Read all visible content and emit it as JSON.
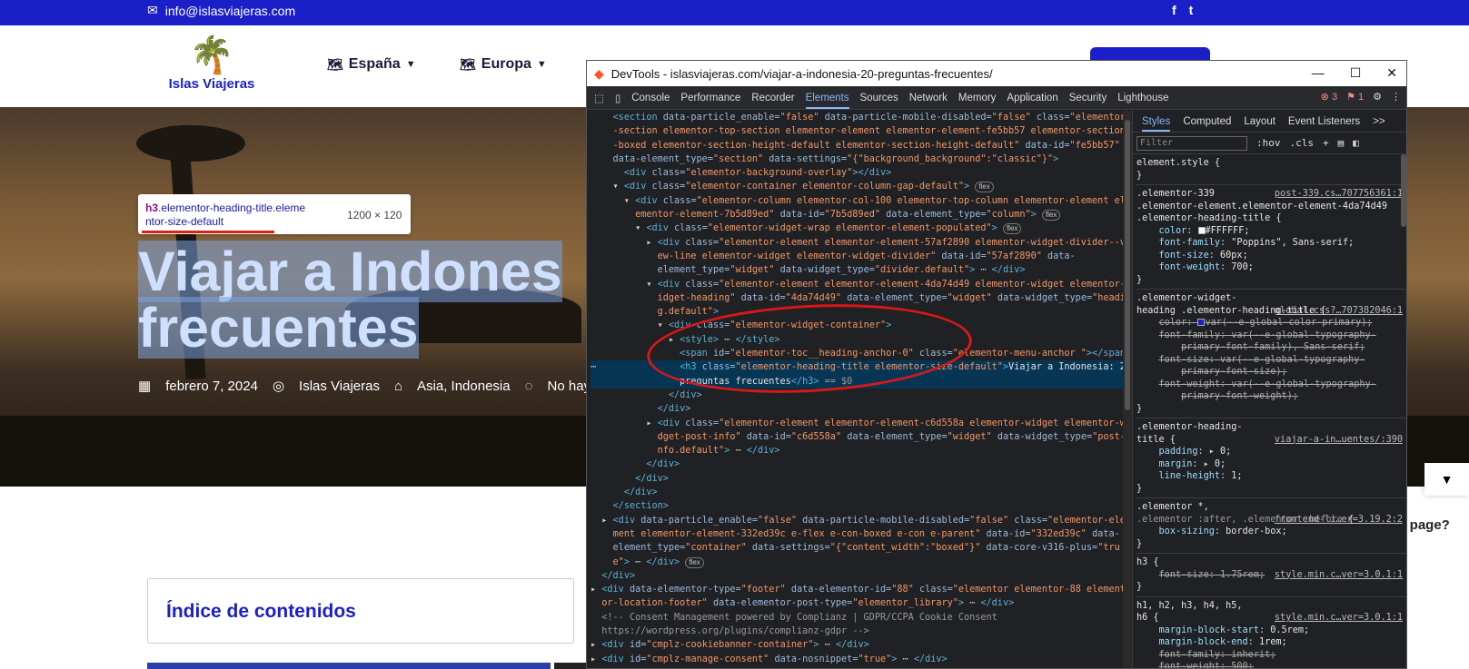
{
  "site": {
    "email": "info@islasviajeras.com",
    "logo_name": "Islas Viajeras",
    "social": [
      "f",
      "t"
    ],
    "nav": [
      {
        "label": "España"
      },
      {
        "label": "Europa"
      }
    ],
    "hero_title_line1": "Viajar a Indones",
    "hero_title_line2": "frecuentes",
    "meta": {
      "date": "febrero 7, 2024",
      "author": "Islas Viajeras",
      "categories": "Asia, Indonesia",
      "comments": "No hay co"
    },
    "toc_title": "Índice de contenidos",
    "cookie_question": "ls page?"
  },
  "tooltip": {
    "tag": "h3",
    "class_line1": ".elementor-heading-title.eleme",
    "class_line2": "ntor-size-default",
    "dimensions": "1200 × 120"
  },
  "devtools": {
    "title": "DevTools - islasviajeras.com/viajar-a-indonesia-20-preguntas-frecuentes/",
    "tabs": [
      "Console",
      "Performance",
      "Recorder",
      "Elements",
      "Sources",
      "Network",
      "Memory",
      "Application",
      "Security",
      "Lighthouse"
    ],
    "active_tab": "Elements",
    "errors": "3",
    "warnings": "1",
    "styles_tabs": [
      "Styles",
      "Computed",
      "Layout",
      "Event Listeners",
      ">>"
    ],
    "filter_placeholder": "Filter",
    "hov": ":hov",
    "cls": ".cls"
  },
  "colors": {
    "brand_blue": "#1b1fc7",
    "devtools_bg": "#202124",
    "selection": "#073655",
    "annotation_red": "#d81818"
  }
}
